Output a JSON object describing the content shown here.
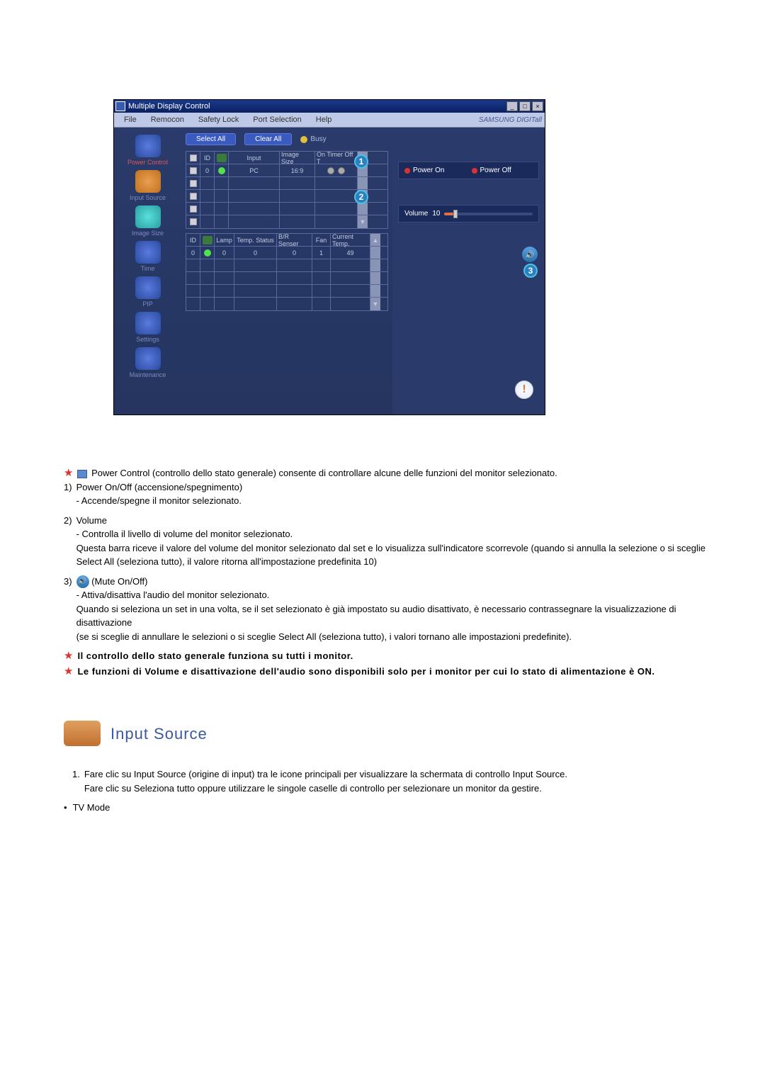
{
  "app": {
    "title": "Multiple Display Control",
    "brand": "SAMSUNG DIGITall"
  },
  "menu": {
    "file": "File",
    "remocon": "Remocon",
    "safety_lock": "Safety Lock",
    "port_selection": "Port Selection",
    "help": "Help"
  },
  "sidebar": {
    "power_control": "Power Control",
    "input_source": "Input Source",
    "image_size": "Image Size",
    "time": "Time",
    "pip": "PIP",
    "settings": "Settings",
    "maintenance": "Maintenance"
  },
  "toolbar": {
    "select_all": "Select All",
    "clear_all": "Clear All",
    "busy": "Busy"
  },
  "grid1": {
    "headers": {
      "id": "ID",
      "input": "Input",
      "image_size": "Image Size",
      "on_timer": "On Timer Off T"
    },
    "row": {
      "id": "0",
      "input": "PC",
      "image_size": "16:9"
    }
  },
  "grid2": {
    "headers": {
      "id": "ID",
      "lamp": "Lamp",
      "temp_status": "Temp. Status",
      "bvr": "B/R Senser",
      "fan": "Fan",
      "current_temp": "Current Temp."
    },
    "row": {
      "id": "0",
      "lamp": "0",
      "temp_status": "0",
      "bvr": "0",
      "fan": "1",
      "current_temp": "49"
    }
  },
  "right": {
    "power_on": "Power On",
    "power_off": "Power Off",
    "volume_label": "Volume",
    "volume_value": "10"
  },
  "callouts": {
    "c1": "1",
    "c2": "2",
    "c3": "3"
  },
  "doc": {
    "star1": "Power Control (controllo dello stato generale) consente di controllare alcune delle funzioni del monitor selezionato.",
    "li1_head": "Power On/Off (accensione/spegnimento)",
    "li1_sub": "- Accende/spegne il monitor selezionato.",
    "li2_head": "Volume",
    "li2_sub1": "- Controlla il livello di volume del monitor selezionato.",
    "li2_sub2": "Questa barra riceve il valore del volume del monitor selezionato dal set e lo visualizza sull'indicatore scorrevole (quando si annulla la selezione o si sceglie Select All (seleziona tutto), il valore ritorna all'impostazione predefinita 10)",
    "li3_head": "(Mute On/Off)",
    "li3_sub1": "- Attiva/disattiva l'audio del monitor selezionato.",
    "li3_sub2": "Quando si seleziona un set in una volta, se il set selezionato è già impostato su audio disattivato, è necessario contrassegnare la visualizzazione di disattivazione",
    "li3_sub3": "(se si sceglie di annullare le selezioni o si sceglie Select All (seleziona tutto), i valori tornano alle impostazioni predefinite).",
    "star2": "Il controllo dello stato generale funziona su tutti i monitor.",
    "star3": "Le funzioni di Volume e disattivazione dell'audio sono disponibili solo per i monitor per cui lo stato di alimentazione è ON.",
    "section_heading": "Input Source",
    "section_li1": "Fare clic su Input Source (origine di input) tra le icone principali per visualizzare la schermata di controllo Input Source.",
    "section_li1b": "Fare clic su Seleziona tutto oppure utilizzare le singole caselle di controllo per selezionare un monitor da gestire.",
    "section_bullet": "TV Mode",
    "num1": "1)",
    "num2": "2)",
    "num3": "3)",
    "ol1": "1."
  }
}
